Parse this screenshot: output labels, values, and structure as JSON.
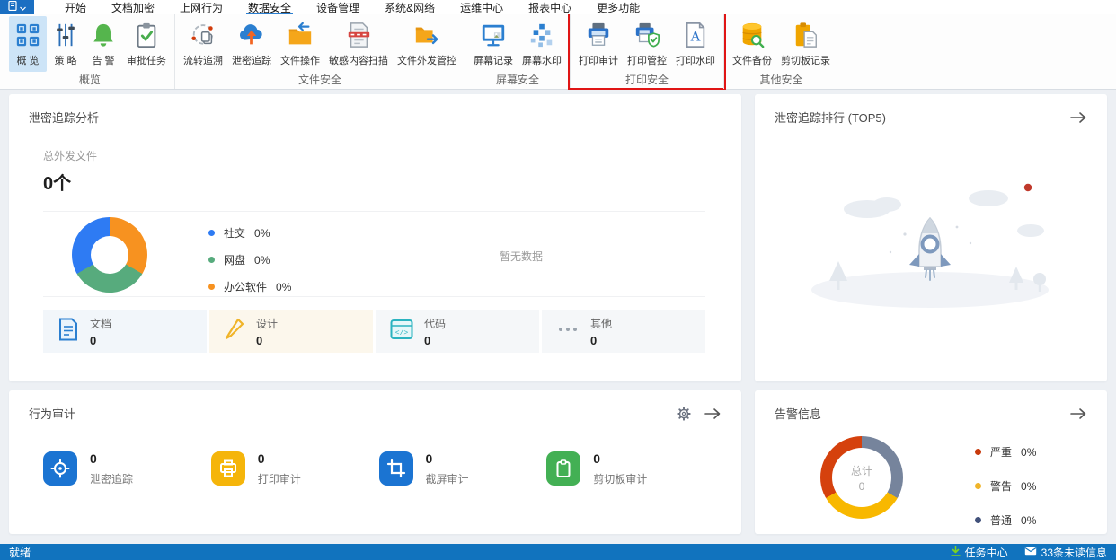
{
  "menu": {
    "items": [
      "开始",
      "文档加密",
      "上网行为",
      "数据安全",
      "设备管理",
      "系统&网络",
      "运维中心",
      "报表中心",
      "更多功能"
    ],
    "active": "数据安全"
  },
  "ribbon": {
    "groups": [
      {
        "caption": "概览",
        "items": [
          {
            "label": "概 览",
            "icon": "overview-grid-icon",
            "selected": true
          },
          {
            "label": "策 略",
            "icon": "policy-sliders-icon"
          },
          {
            "label": "告 警",
            "icon": "alert-bell-icon"
          },
          {
            "label": "审批任务",
            "icon": "approval-tasks-icon"
          }
        ]
      },
      {
        "caption": "文件安全",
        "items": [
          {
            "label": "流转追溯",
            "icon": "circulation-trace-icon"
          },
          {
            "label": "泄密追踪",
            "icon": "leak-trace-cloud-icon"
          },
          {
            "label": "文件操作",
            "icon": "file-operation-folder-icon"
          },
          {
            "label": "敏感内容扫描",
            "icon": "sensitive-content-scan-icon"
          },
          {
            "label": "文件外发管控",
            "icon": "file-outgoing-control-icon"
          }
        ]
      },
      {
        "caption": "屏幕安全",
        "items": [
          {
            "label": "屏幕记录",
            "icon": "screen-record-icon"
          },
          {
            "label": "屏幕水印",
            "icon": "screen-watermark-icon"
          }
        ]
      },
      {
        "caption": "打印安全",
        "highlighted": true,
        "highlight_color": "#e01515",
        "items": [
          {
            "label": "打印审计",
            "icon": "print-audit-icon"
          },
          {
            "label": "打印管控",
            "icon": "print-control-icon"
          },
          {
            "label": "打印水印",
            "icon": "print-watermark-icon"
          }
        ]
      },
      {
        "caption": "其他安全",
        "items": [
          {
            "label": "文件备份",
            "icon": "file-backup-icon"
          },
          {
            "label": "剪切板记录",
            "icon": "clipboard-record-icon"
          }
        ]
      }
    ]
  },
  "panels": {
    "leak_analysis": {
      "title": "泄密追踪分析",
      "total_label": "总外发文件",
      "total_value": "0个",
      "empty_text": "暂无数据",
      "legend": [
        {
          "label": "社交",
          "value": "0%",
          "color": "#2e7bf3"
        },
        {
          "label": "网盘",
          "value": "0%",
          "color": "#57ab7d"
        },
        {
          "label": "办公软件",
          "value": "0%",
          "color": "#f79220"
        }
      ],
      "cards": [
        {
          "label": "文档",
          "value": "0",
          "icon": "document-icon"
        },
        {
          "label": "设计",
          "value": "0",
          "icon": "pencil-icon"
        },
        {
          "label": "代码",
          "value": "0",
          "icon": "code-icon"
        },
        {
          "label": "其他",
          "value": "0",
          "icon": "ellipsis-icon"
        }
      ]
    },
    "leak_ranking": {
      "title": "泄密追踪排行 (TOP5)"
    },
    "behavior_audit": {
      "title": "行为审计",
      "stats": [
        {
          "value": "0",
          "label": "泄密追踪",
          "icon": "target-icon",
          "color": "#1b74d2"
        },
        {
          "value": "0",
          "label": "打印审计",
          "icon": "printer-icon",
          "color": "#f5b50a"
        },
        {
          "value": "0",
          "label": "截屏审计",
          "icon": "crop-icon",
          "color": "#1b74d2"
        },
        {
          "value": "0",
          "label": "剪切板审计",
          "icon": "clipboard-icon",
          "color": "#43b054"
        }
      ]
    },
    "alerts": {
      "title": "告警信息",
      "center_label": "总计",
      "center_value": "0",
      "legend": [
        {
          "label": "严重",
          "value": "0%",
          "color": "#c8390b"
        },
        {
          "label": "警告",
          "value": "0%",
          "color": "#f0b429"
        },
        {
          "label": "普通",
          "value": "0%",
          "color": "#41517a"
        }
      ]
    }
  },
  "statusbar": {
    "ready": "就绪",
    "task_center": "任务中心",
    "unread": "33条未读信息"
  },
  "colors": {
    "accent_blue": "#2b7fd0",
    "menubar_bg": "#ffffff",
    "statusbar_bg": "#1173be",
    "ribbon_selected_bg": "#cde4f7",
    "content_bg": "#edf0f4",
    "highlight_red": "#e01515"
  },
  "chart_data": [
    {
      "type": "pie",
      "title": "泄密追踪分析",
      "categories": [
        "社交",
        "网盘",
        "办公软件"
      ],
      "values": [
        0,
        0,
        0
      ],
      "labels": [
        "社交 0%",
        "网盘 0%",
        "办公软件 0%"
      ],
      "colors": [
        "#2e7bf3",
        "#57ab7d",
        "#f79220"
      ],
      "note": "donut rendered as three equal placeholder segments, all values 0",
      "legend_position": "right"
    },
    {
      "type": "pie",
      "title": "告警信息",
      "categories": [
        "严重",
        "警告",
        "普通"
      ],
      "values": [
        0,
        0,
        0
      ],
      "labels": [
        "严重 0%",
        "警告 0%",
        "普通 0%"
      ],
      "colors": [
        "#d5410d",
        "#f8b800",
        "#76849c"
      ],
      "center_text": "总计 0",
      "note": "donut rendered as three equal placeholder segments, all values 0",
      "legend_position": "right"
    }
  ]
}
